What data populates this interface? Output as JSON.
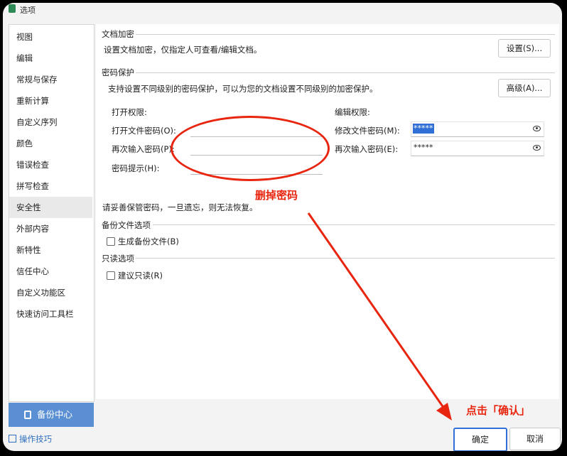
{
  "window": {
    "title": "选项"
  },
  "sidebar": {
    "items": [
      {
        "label": "视图"
      },
      {
        "label": "编辑"
      },
      {
        "label": "常规与保存"
      },
      {
        "label": "重新计算"
      },
      {
        "label": "自定义序列"
      },
      {
        "label": "颜色"
      },
      {
        "label": "错误检查"
      },
      {
        "label": "拼写检查"
      },
      {
        "label": "安全性",
        "active": true
      },
      {
        "label": "外部内容"
      },
      {
        "label": "新特性"
      },
      {
        "label": "信任中心"
      },
      {
        "label": "自定义功能区"
      },
      {
        "label": "快速访问工具栏"
      }
    ],
    "backup_button": "备份中心",
    "tips_link": "操作技巧"
  },
  "encrypt": {
    "title": "文档加密",
    "desc": "设置文档加密，仅指定人可查看/编辑文档。",
    "button": "设置(S)..."
  },
  "password": {
    "title": "密码保护",
    "desc": "支持设置不同级别的密码保护，可以为您的文档设置不同级别的加密保护。",
    "button": "高级(A)...",
    "open_perm": "打开权限:",
    "open_pw_label": "打开文件密码(O):",
    "open_pw2_label": "再次输入密码(P):",
    "hint_label": "密码提示(H):",
    "edit_perm": "编辑权限:",
    "edit_pw_label": "修改文件密码(M):",
    "edit_pw_value": "*****",
    "edit_pw2_label": "再次输入密码(E):",
    "edit_pw2_value": "*****",
    "note": "请妥善保管密码，一旦遗忘，则无法恢复。"
  },
  "backup": {
    "title": "备份文件选项",
    "checkbox": "生成备份文件(B)",
    "checked": false
  },
  "readonly": {
    "title": "只读选项",
    "checkbox": "建议只读(R)",
    "checked": false
  },
  "footer": {
    "ok": "确定",
    "cancel": "取消"
  },
  "annotations": {
    "delete_password": "删掉密码",
    "click_confirm": "点击「确认」",
    "color": "#e8250f"
  }
}
